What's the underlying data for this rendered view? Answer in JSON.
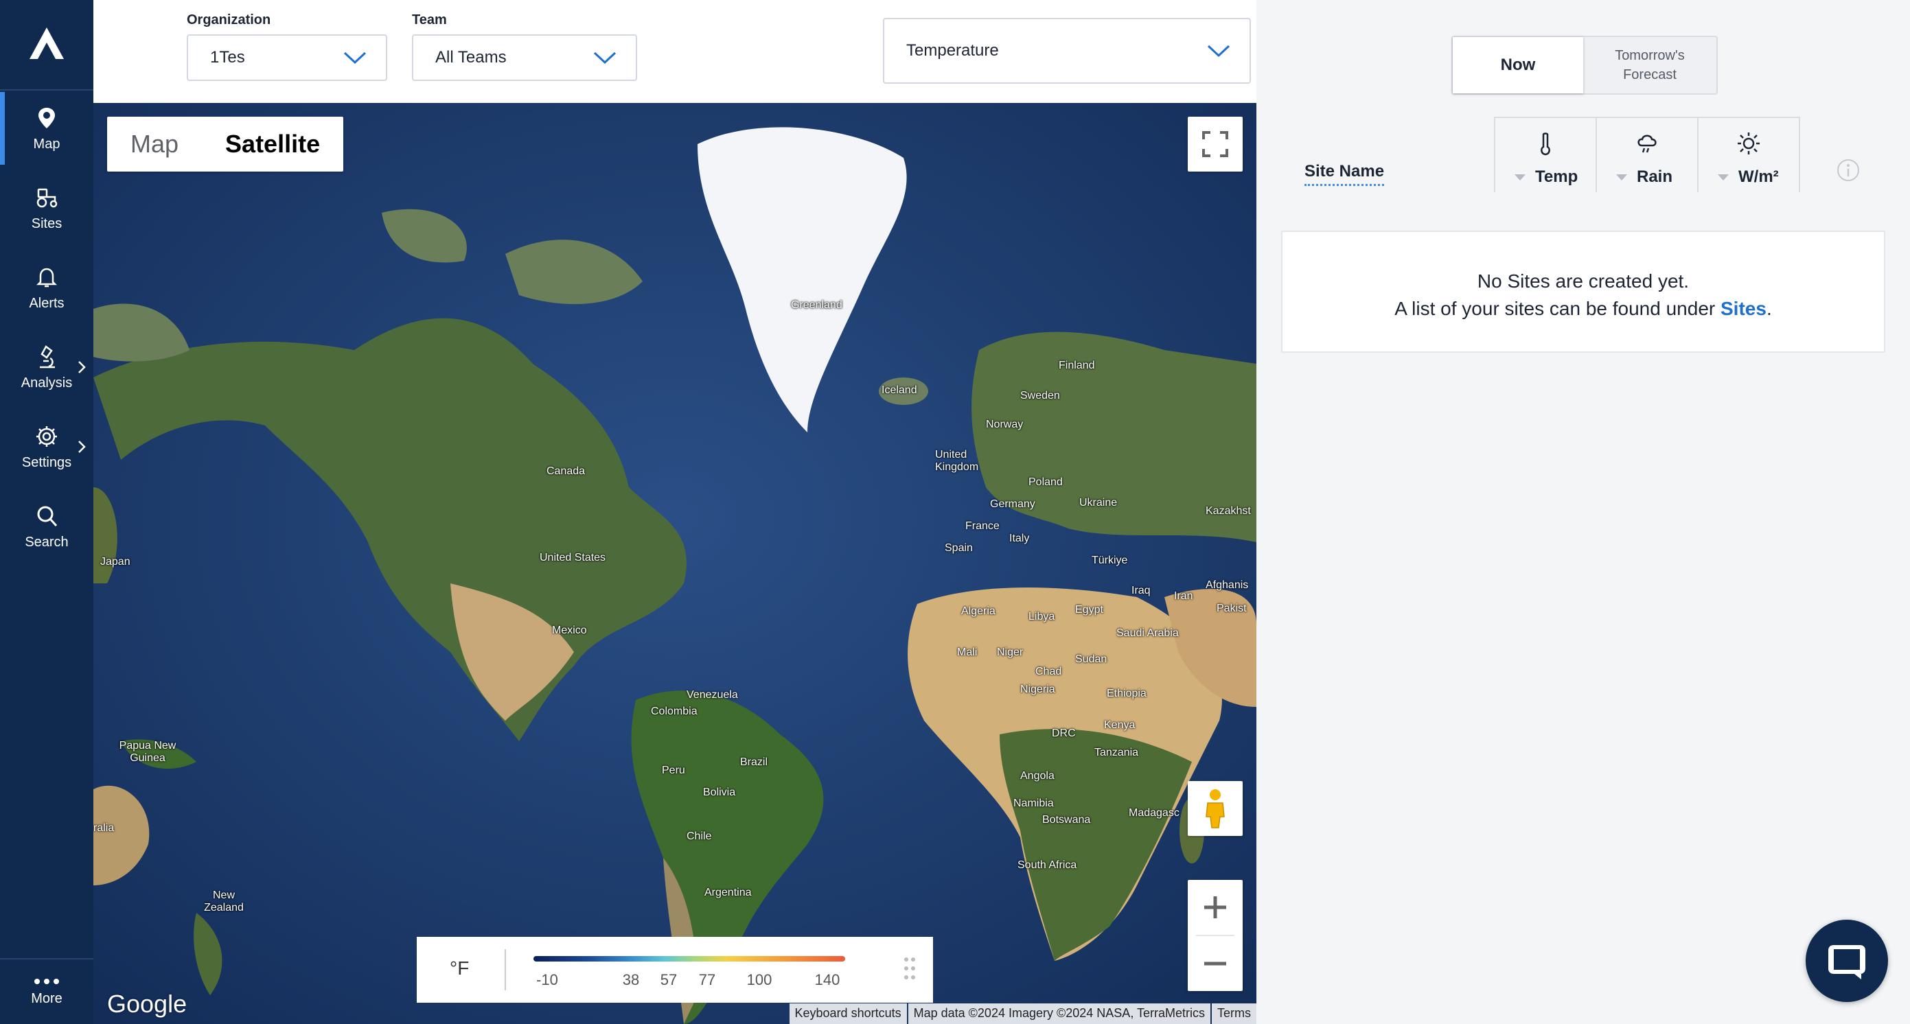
{
  "sidebar": {
    "items": [
      {
        "label": "Map",
        "icon": "map-pin-icon"
      },
      {
        "label": "Sites",
        "icon": "tractor-icon"
      },
      {
        "label": "Alerts",
        "icon": "bell-icon"
      },
      {
        "label": "Analysis",
        "icon": "microscope-icon"
      },
      {
        "label": "Settings",
        "icon": "gear-icon"
      },
      {
        "label": "Search",
        "icon": "search-icon"
      }
    ],
    "more_label": "More"
  },
  "filters": {
    "organization_label": "Organization",
    "organization_value": "1Tes",
    "team_label": "Team",
    "team_value": "All Teams",
    "layer_value": "Temperature"
  },
  "map": {
    "type_map_label": "Map",
    "type_satellite_label": "Satellite",
    "selected_type": "Satellite",
    "countries": [
      "Greenland",
      "Iceland",
      "Finland",
      "Sweden",
      "Norway",
      "United Kingdom",
      "Poland",
      "Ukraine",
      "Germany",
      "France",
      "Italy",
      "Spain",
      "Kazakhst",
      "Türkiye",
      "Iraq",
      "Iran",
      "Afghanis",
      "Pakist",
      "Algeria",
      "Libya",
      "Egypt",
      "Saudi Arabia",
      "Mali",
      "Niger",
      "Chad",
      "Sudan",
      "Nigeria",
      "Ethiopia",
      "DRC",
      "Kenya",
      "Tanzania",
      "Angola",
      "Namibia",
      "Madagasc",
      "Botswana",
      "South Africa",
      "Canada",
      "United States",
      "Mexico",
      "Venezuela",
      "Colombia",
      "Peru",
      "Brazil",
      "Bolivia",
      "Chile",
      "Argentina",
      "Japan",
      "Papua New Guinea",
      "ralia",
      "New Zealand"
    ],
    "legend": {
      "unit": "°F",
      "ticks": [
        "-10",
        "38",
        "57",
        "77",
        "100",
        "140"
      ]
    },
    "google_logo": "Google",
    "attribution": [
      "Keyboard shortcuts",
      "Map data ©2024 Imagery ©2024 NASA, TerraMetrics",
      "Terms"
    ]
  },
  "panel": {
    "toggle_now": "Now",
    "toggle_tomorrow": "Tomorrow's Forecast",
    "site_name_header": "Site Name",
    "metrics": [
      {
        "label": "Temp",
        "icon": "thermometer-icon"
      },
      {
        "label": "Rain",
        "icon": "rain-cloud-icon"
      },
      {
        "label": "W/m²",
        "icon": "sun-icon"
      }
    ],
    "empty_line1": "No Sites are created yet.",
    "empty_line2_prefix": "A list of your sites can be found under ",
    "empty_link": "Sites",
    "empty_suffix": "."
  },
  "colors": {
    "sidebar_bg": "#10294f",
    "accent": "#3b8be8",
    "link": "#1f6fce"
  }
}
